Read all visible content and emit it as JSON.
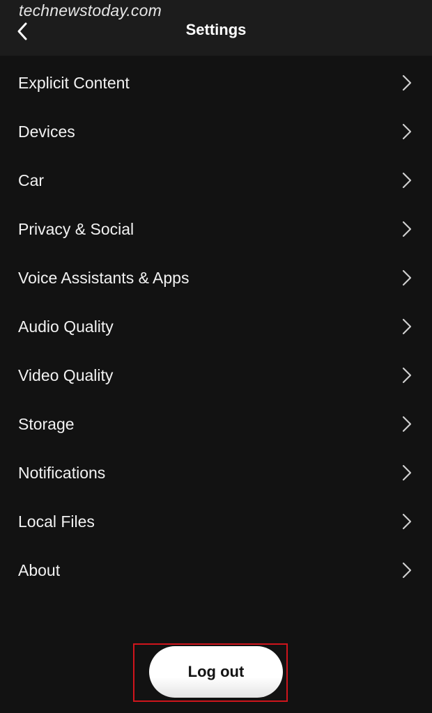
{
  "watermark": "technewstoday.com",
  "header": {
    "title": "Settings",
    "back_icon": "chevron-left-icon"
  },
  "menu": {
    "items": [
      {
        "label": "Explicit Content",
        "icon": "chevron-right-icon"
      },
      {
        "label": "Devices",
        "icon": "chevron-right-icon"
      },
      {
        "label": "Car",
        "icon": "chevron-right-icon"
      },
      {
        "label": "Privacy & Social",
        "icon": "chevron-right-icon"
      },
      {
        "label": "Voice Assistants & Apps",
        "icon": "chevron-right-icon"
      },
      {
        "label": "Audio Quality",
        "icon": "chevron-right-icon"
      },
      {
        "label": "Video Quality",
        "icon": "chevron-right-icon"
      },
      {
        "label": "Storage",
        "icon": "chevron-right-icon"
      },
      {
        "label": "Notifications",
        "icon": "chevron-right-icon"
      },
      {
        "label": "Local Files",
        "icon": "chevron-right-icon"
      },
      {
        "label": "About",
        "icon": "chevron-right-icon"
      }
    ]
  },
  "logout": {
    "label": "Log out",
    "highlight_color": "#d0151c"
  },
  "colors": {
    "background": "#121212",
    "header": "#1c1c1c",
    "text": "#ffffff",
    "button": "#ffffff"
  }
}
